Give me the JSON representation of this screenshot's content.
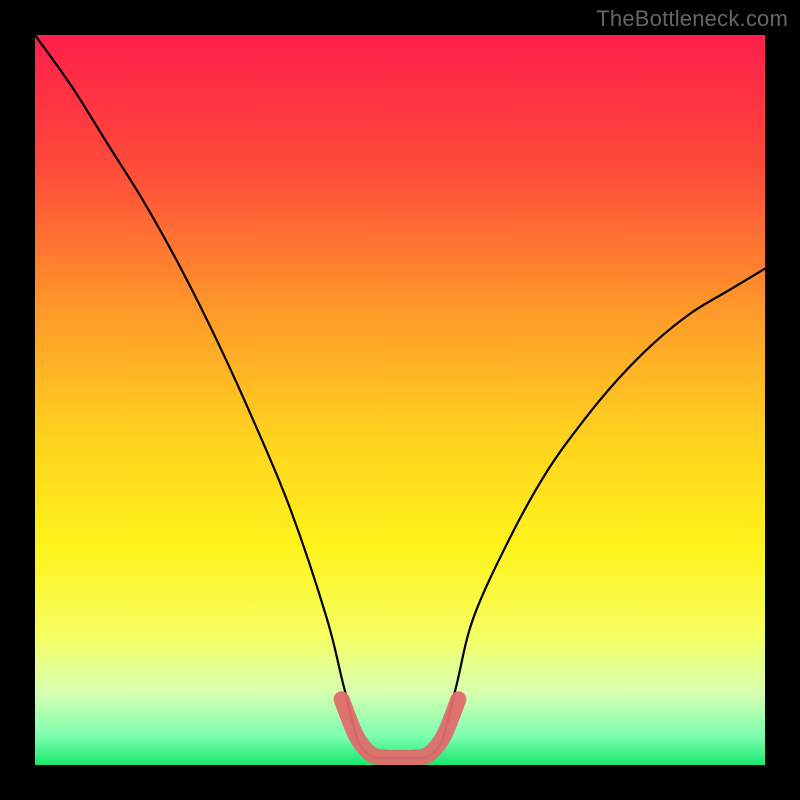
{
  "watermark": "TheBottleneck.com",
  "chart_data": {
    "type": "line",
    "title": "",
    "xlabel": "",
    "ylabel": "",
    "xlim": [
      0,
      1
    ],
    "ylim": [
      0,
      1
    ],
    "series": [
      {
        "name": "bottleneck-curve",
        "x": [
          0.0,
          0.05,
          0.1,
          0.15,
          0.2,
          0.25,
          0.3,
          0.35,
          0.4,
          0.425,
          0.45,
          0.5,
          0.55,
          0.575,
          0.6,
          0.65,
          0.7,
          0.75,
          0.8,
          0.85,
          0.9,
          0.95,
          1.0
        ],
        "y": [
          1.0,
          0.93,
          0.85,
          0.77,
          0.68,
          0.58,
          0.47,
          0.35,
          0.2,
          0.1,
          0.02,
          0.01,
          0.02,
          0.1,
          0.2,
          0.31,
          0.4,
          0.47,
          0.53,
          0.58,
          0.62,
          0.65,
          0.68
        ]
      }
    ],
    "highlight": {
      "name": "low-bottleneck-band",
      "x": [
        0.42,
        0.44,
        0.46,
        0.48,
        0.5,
        0.52,
        0.54,
        0.56,
        0.58
      ],
      "y": [
        0.09,
        0.04,
        0.015,
        0.01,
        0.01,
        0.01,
        0.015,
        0.04,
        0.09
      ]
    },
    "gradient_stops": [
      {
        "offset": 0.0,
        "color": "#ff1f4b"
      },
      {
        "offset": 0.18,
        "color": "#ff4a3a"
      },
      {
        "offset": 0.38,
        "color": "#ff9a2a"
      },
      {
        "offset": 0.55,
        "color": "#ffd21f"
      },
      {
        "offset": 0.7,
        "color": "#fff31a"
      },
      {
        "offset": 0.82,
        "color": "#f6ff60"
      },
      {
        "offset": 0.9,
        "color": "#d8ffb0"
      },
      {
        "offset": 0.96,
        "color": "#7dffb0"
      },
      {
        "offset": 1.0,
        "color": "#17e86e"
      }
    ],
    "colors": {
      "curve": "#000000",
      "highlight": "#e06b6b"
    }
  }
}
